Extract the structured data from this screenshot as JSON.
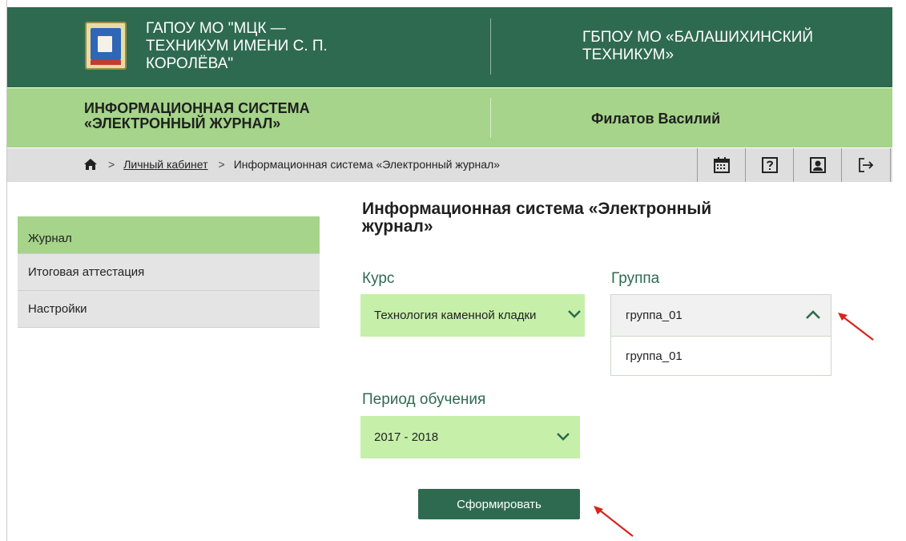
{
  "header": {
    "org_left": "ГАПОУ МО \"МЦК —\nТЕХНИКУМ ИМЕНИ С. П.\nКОРОЛЁВА\"",
    "org_right": "ГБПОУ МО «БАЛАШИХИНСКИЙ\nТЕХНИКУМ»",
    "logo_icon": "college-emblem-logo"
  },
  "system_bar": {
    "title": "ИНФОРМАЦИОННАЯ СИСТЕМА\n«ЭЛЕКТРОННЫЙ ЖУРНАЛ»",
    "user_name": "Филатов Василий"
  },
  "breadcrumb": {
    "home_icon": "home-icon",
    "items": [
      "Личный кабинет",
      "Информационная система «Электронный журнал»"
    ],
    "separator": ">"
  },
  "toolbar": {
    "icons": [
      "calendar-icon",
      "help-icon",
      "profile-icon",
      "logout-icon"
    ]
  },
  "sidebar": {
    "items": [
      {
        "label": "Журнал",
        "active": true
      },
      {
        "label": "Итоговая аттестация",
        "active": false
      },
      {
        "label": "Настройки",
        "active": false
      }
    ]
  },
  "main": {
    "title": "Информационная система «Электронный\nжурнал»",
    "course": {
      "label": "Курс",
      "value": "Технология каменной кладки"
    },
    "group": {
      "label": "Группа",
      "value": "группа_01",
      "options": [
        "группа_01"
      ]
    },
    "period": {
      "label": "Период обучения",
      "value": "2017 - 2018"
    },
    "submit_label": "Сформировать"
  },
  "colors": {
    "header_green": "#2e6a4f",
    "bar_green": "#a5d48a",
    "select_green": "#c6f0a9",
    "annotation_red": "#d9231d"
  }
}
